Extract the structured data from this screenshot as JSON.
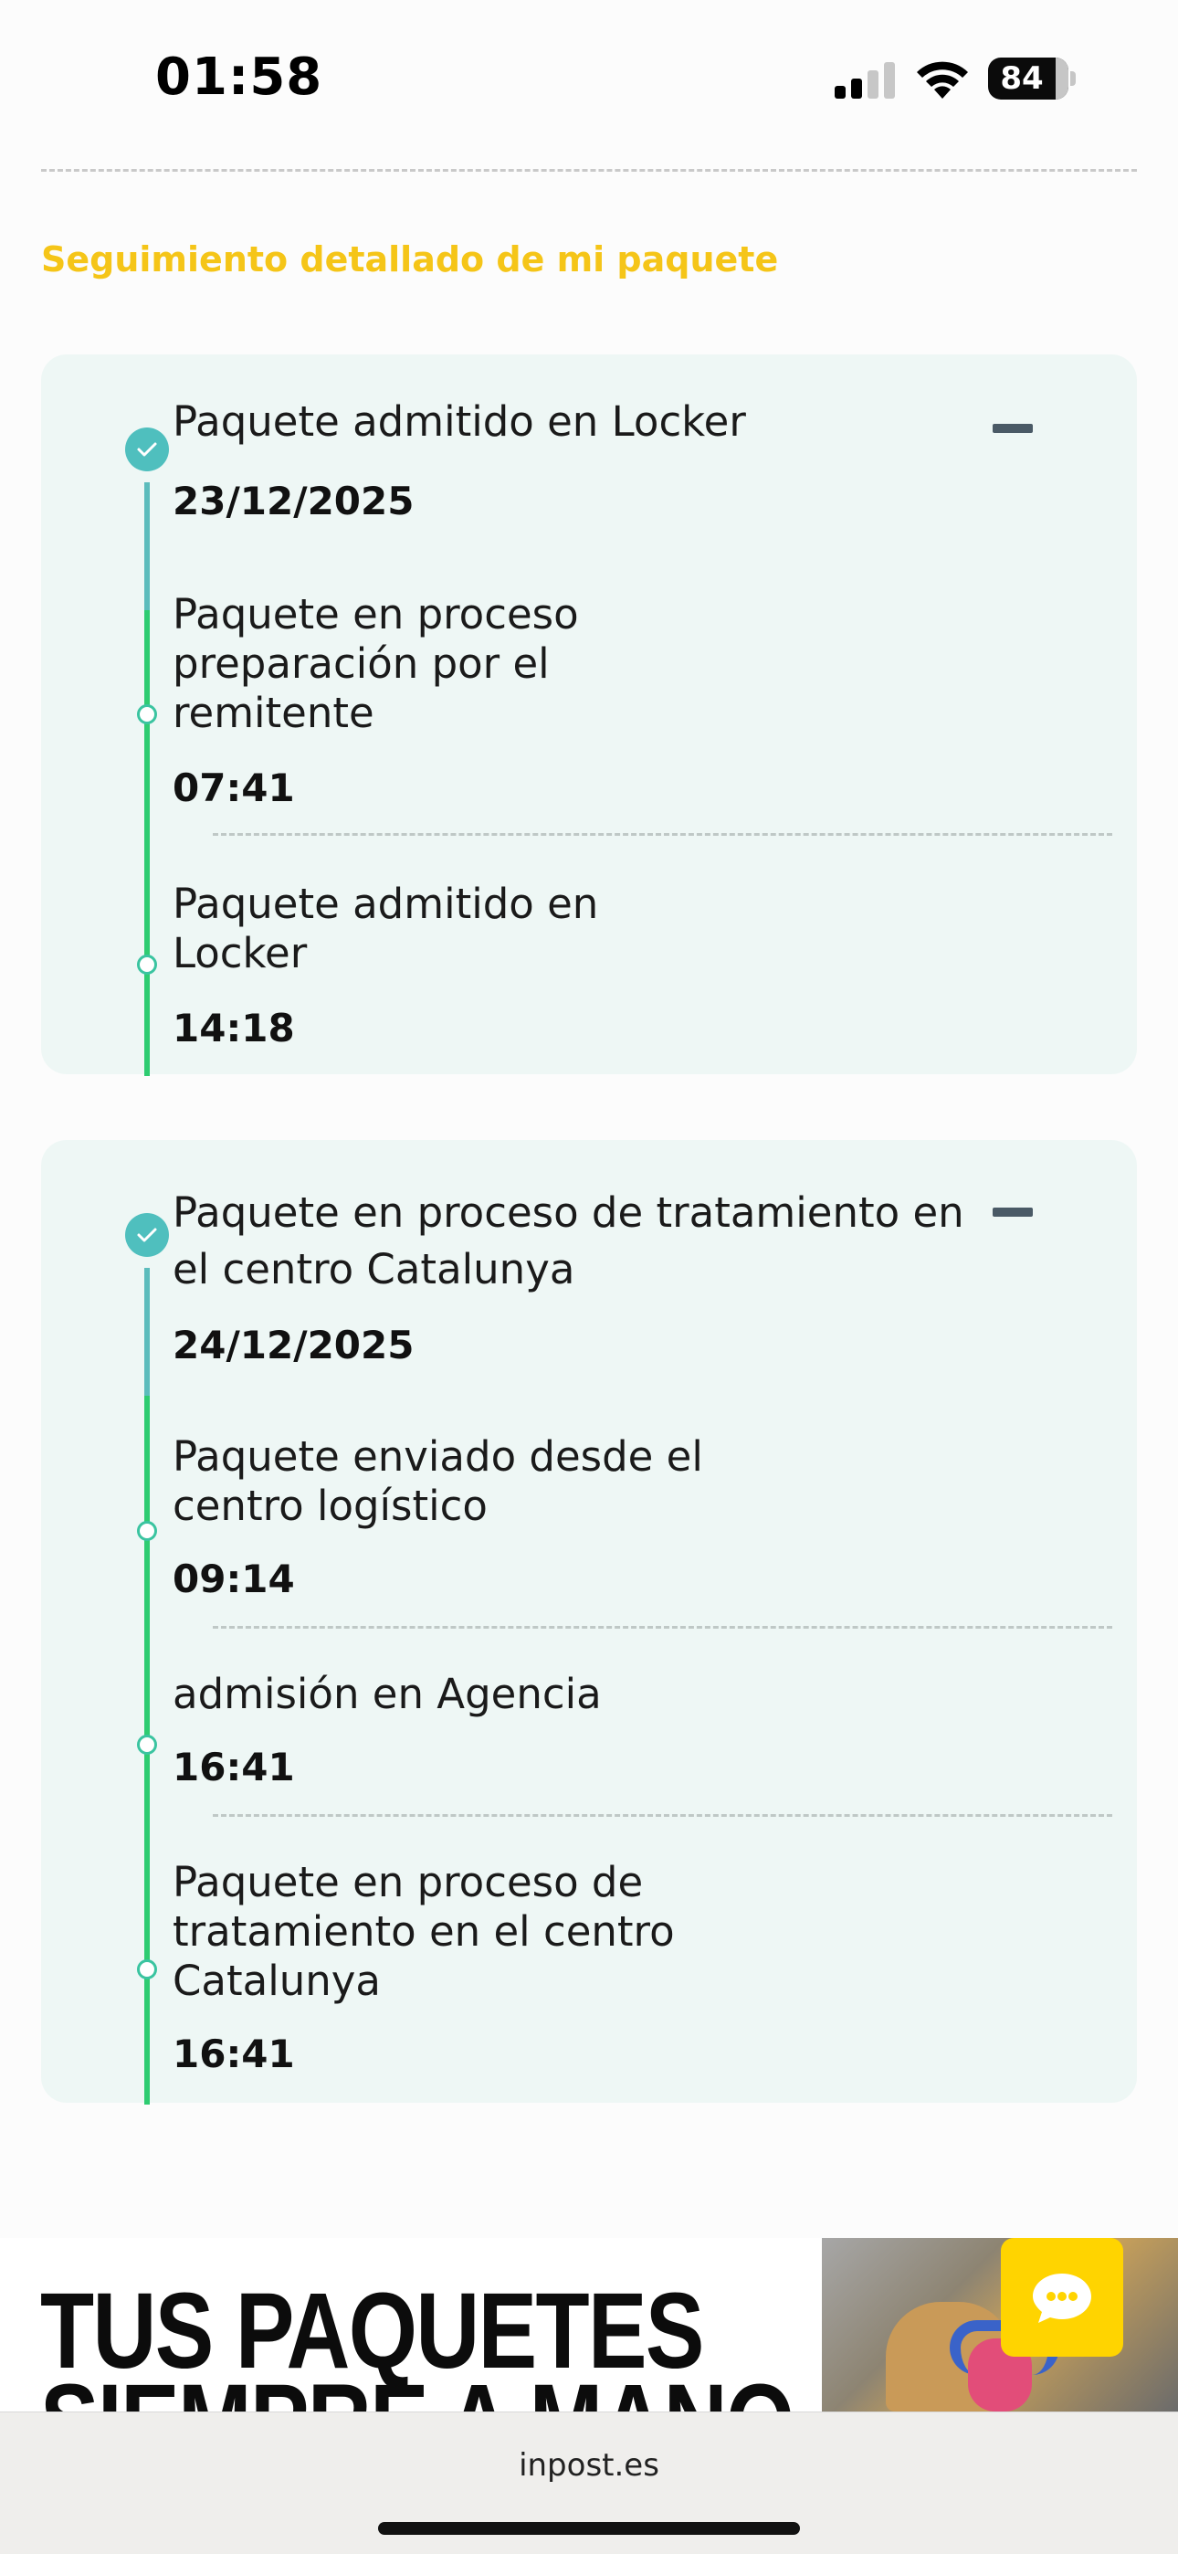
{
  "status_bar": {
    "time": "01:58",
    "battery": "84",
    "icons": [
      "signal-icon",
      "wifi-icon",
      "battery-icon"
    ]
  },
  "section_title": "Seguimiento detallado de mi paquete",
  "groups": [
    {
      "title": "Paquete admitido en Locker",
      "date": "23/12/2025",
      "events": [
        {
          "title": "Paquete en proceso preparación por el remitente",
          "time": "07:41"
        },
        {
          "title": "Paquete admitido en Locker",
          "time": "14:18"
        }
      ]
    },
    {
      "title": "Paquete en proceso de tratamiento en el centro Catalunya",
      "date": "24/12/2025",
      "events": [
        {
          "title": "Paquete enviado desde el centro logístico",
          "time": "09:14"
        },
        {
          "title": "admisión en Agencia",
          "time": "16:41"
        },
        {
          "title": "Paquete en proceso de tratamiento en el centro Catalunya",
          "time": "16:41"
        }
      ]
    }
  ],
  "banner": {
    "line1": "TUS PAQUETES",
    "line2": "SIEMPRE A MANO EN"
  },
  "chat_button_icon": "chat-bubble-icon",
  "browser": {
    "url": "inpost.es"
  },
  "colors": {
    "accent_yellow": "#f5c518",
    "card_bg": "#eef7f5",
    "timeline_green": "#2ecc71",
    "timeline_teal": "#5cbcbc",
    "chat_yellow": "#ffd400"
  }
}
